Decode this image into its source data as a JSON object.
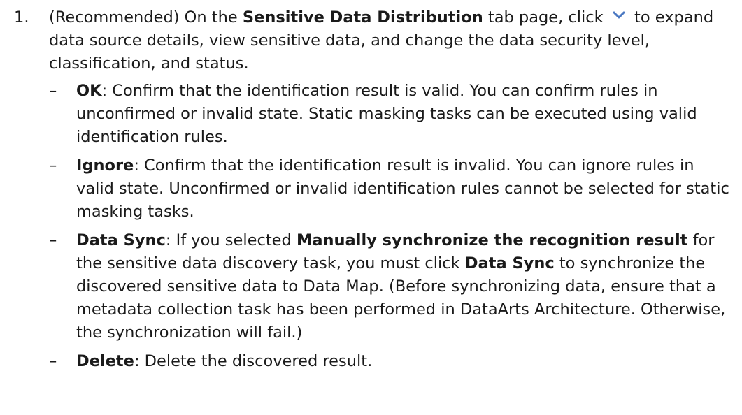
{
  "step": {
    "number": "1.",
    "p1": "(Recommended) On the ",
    "tab_name": "Sensitive Data Distribution",
    "p2": " tab page, click ",
    "expand_icon": "chevron-down-icon",
    "p3": " to expand data source details, view sensitive data, and change the data security level, classification, and status."
  },
  "dash": "–",
  "ok": {
    "term": "OK",
    "text": ": Confirm that the identification result is valid. You can confirm rules in unconfirmed or invalid state. Static masking tasks can be executed using valid identification rules."
  },
  "ignore": {
    "term": "Ignore",
    "text": ": Confirm that the identification result is invalid. You can ignore rules in valid state. Unconfirmed or invalid identification rules cannot be selected for static masking tasks."
  },
  "datasync": {
    "term": "Data Sync",
    "t1": ": If you selected ",
    "option": "Manually synchronize the recognition result",
    "t2": " for the sensitive data discovery task, you must click ",
    "button": "Data Sync",
    "t3": " to synchronize the discovered sensitive data to Data Map. (Before synchronizing data, ensure that a metadata collection task has been performed in DataArts Architecture. Otherwise, the synchronization will fail.)"
  },
  "delete": {
    "term": "Delete",
    "text": ": Delete the discovered result."
  },
  "colors": {
    "text": "#1a1a1a",
    "icon": "#4a78c2"
  }
}
